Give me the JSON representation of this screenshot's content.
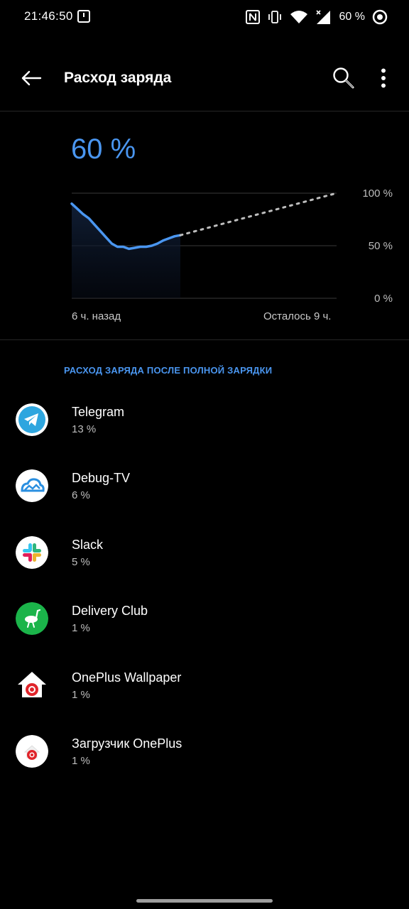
{
  "status_bar": {
    "time": "21:46:50",
    "battery_percent": "60 %",
    "icons": [
      "notification-icon",
      "nfc-icon",
      "vibrate-icon",
      "wifi-icon",
      "signal-icon",
      "battery-icon"
    ]
  },
  "app_bar": {
    "title": "Расход заряда",
    "icons": [
      "back-arrow-icon",
      "search-icon",
      "more-vert-icon"
    ]
  },
  "battery": {
    "level": "60 %"
  },
  "chart_data": {
    "type": "line",
    "y_tick_labels": [
      "100 %",
      "50 %",
      "0 %"
    ],
    "ylim": [
      0,
      100
    ],
    "x_start_label": "6 ч. назад",
    "x_end_label": "Осталось 9 ч.",
    "series": [
      {
        "values": [
          90,
          85,
          80,
          76,
          70,
          64,
          58,
          52,
          49,
          49,
          47,
          48,
          49,
          49,
          50,
          52,
          55,
          57,
          59,
          60
        ]
      }
    ],
    "prediction": [
      60,
      100
    ],
    "line_color": "#4a96f0"
  },
  "section": {
    "title": "РАСХОД ЗАРЯДА ПОСЛЕ ПОЛНОЙ ЗАРЯДКИ"
  },
  "apps": [
    {
      "name": "Telegram",
      "usage": "13 %",
      "icon": "telegram-icon"
    },
    {
      "name": "Debug-TV",
      "usage": "6 %",
      "icon": "debug-tv-icon"
    },
    {
      "name": "Slack",
      "usage": "5 %",
      "icon": "slack-icon"
    },
    {
      "name": "Delivery Club",
      "usage": "1 %",
      "icon": "delivery-club-icon"
    },
    {
      "name": "OnePlus Wallpaper",
      "usage": "1 %",
      "icon": "oneplus-wallpaper-icon"
    },
    {
      "name": "Загрузчик OnePlus",
      "usage": "1 %",
      "icon": "oneplus-loader-icon"
    }
  ]
}
